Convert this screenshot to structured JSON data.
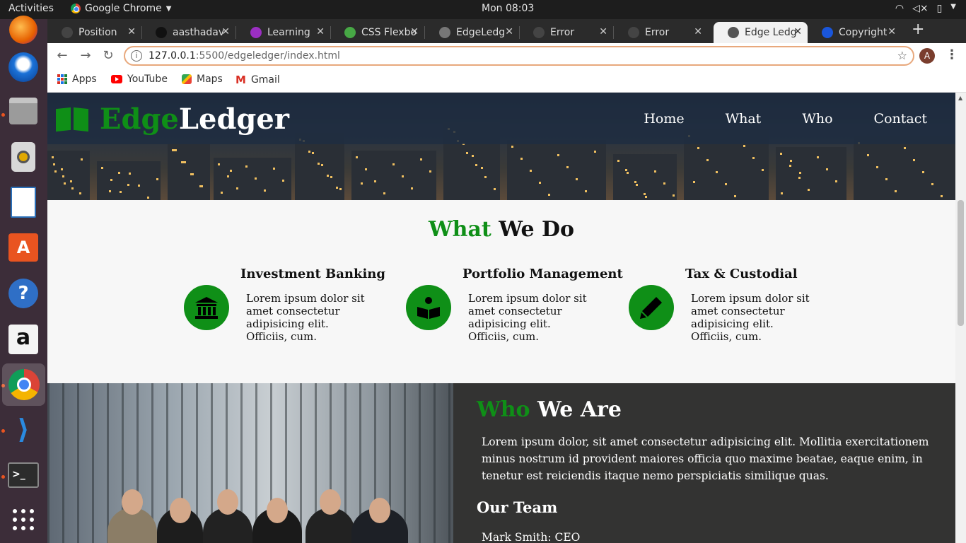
{
  "system": {
    "activities": "Activities",
    "app_name": "Google Chrome",
    "clock": "Mon 08:03"
  },
  "tabs": [
    {
      "title": "Position",
      "fav_color": "#444444"
    },
    {
      "title": "aasthadav",
      "fav_color": "#111111"
    },
    {
      "title": "Learning",
      "fav_color": "#9b2fc2"
    },
    {
      "title": "CSS Flexbo",
      "fav_color": "#47a845"
    },
    {
      "title": "EdgeLedg",
      "fav_color": "#777777"
    },
    {
      "title": "Error",
      "fav_color": "#444444"
    },
    {
      "title": "Error",
      "fav_color": "#444444"
    },
    {
      "title": "Edge Ledg",
      "fav_color": "#555555",
      "active": true
    },
    {
      "title": "Copyright",
      "fav_color": "#1a56db"
    }
  ],
  "omnibox": {
    "host": "127.0.0.1",
    "rest": ":5500/edgeledger/index.html",
    "avatar_letter": "A"
  },
  "bookmarks": {
    "apps": "Apps",
    "youtube": "YouTube",
    "maps": "Maps",
    "gmail": "Gmail"
  },
  "site": {
    "logo_green": "Edge",
    "logo_white": "Ledger",
    "nav": [
      "Home",
      "What",
      "Who",
      "Contact"
    ],
    "accent_color": "#0f8f17",
    "what": {
      "title_green": "What",
      "title_rest": "We Do",
      "services": [
        {
          "title": "Investment Banking",
          "icon": "bank-icon",
          "text": "Lorem ipsum dolor sit amet consectetur adipisicing elit. Officiis, cum."
        },
        {
          "title": "Portfolio Management",
          "icon": "book-reader-icon",
          "text": "Lorem ipsum dolor sit amet consectetur adipisicing elit. Officiis, cum."
        },
        {
          "title": "Tax & Custodial",
          "icon": "pencil-icon",
          "text": "Lorem ipsum dolor sit amet consectetur adipisicing elit. Officiis, cum."
        }
      ]
    },
    "who": {
      "title_green": "Who",
      "title_rest": "We Are",
      "text": "Lorem ipsum dolor, sit amet consectetur adipisicing elit. Mollitia exercitationem minus nostrum id provident maiores officia quo maxime beatae, eaque enim, in tenetur est reiciendis itaque nemo perspiciatis similique quas.",
      "team_heading": "Our Team",
      "team": [
        "Mark Smith: CEO"
      ]
    }
  }
}
